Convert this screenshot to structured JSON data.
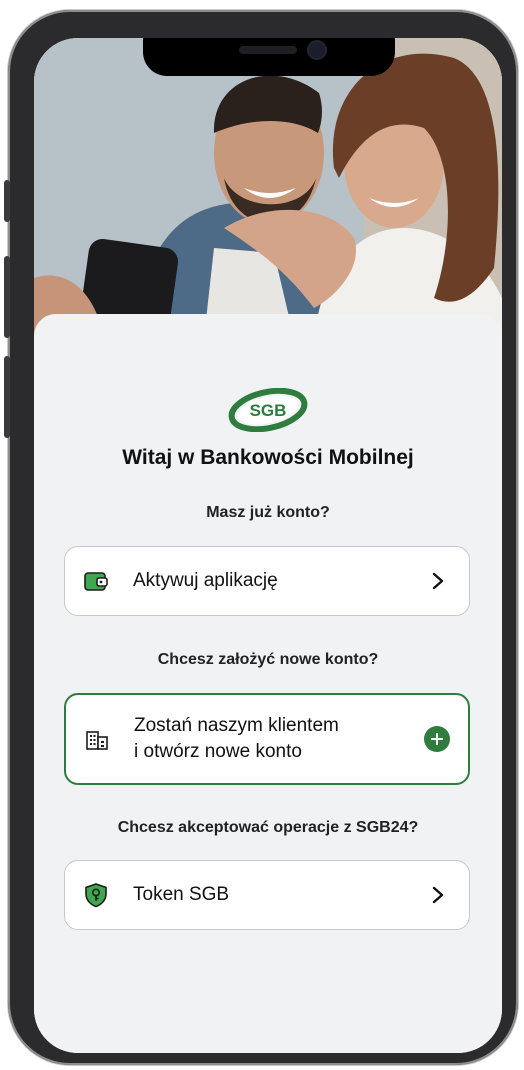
{
  "brand": {
    "logo_text": "SGB",
    "green": "#2e7d3e",
    "light_green": "#3fa84e"
  },
  "welcome_title": "Witaj w Bankowości Mobilnej",
  "sections": {
    "existing": {
      "question": "Masz już konto?",
      "button_label": "Aktywuj aplikację",
      "icon": "wallet-icon",
      "action_icon": "chevron-right-icon"
    },
    "new_account": {
      "question": "Chcesz założyć nowe konto?",
      "line1": "Zostań naszym klientem",
      "line2": "i otwórz nowe konto",
      "icon": "bank-building-icon",
      "action_icon": "plus-icon"
    },
    "token": {
      "question": "Chcesz akceptować operacje z SGB24?",
      "button_label": "Token SGB",
      "icon": "shield-key-icon",
      "action_icon": "chevron-right-icon"
    }
  }
}
